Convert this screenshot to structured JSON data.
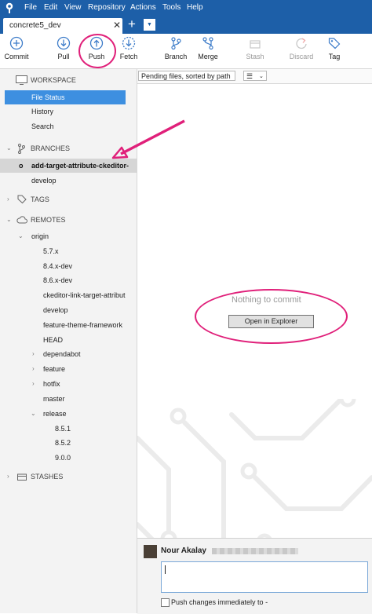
{
  "menu": [
    "File",
    "Edit",
    "View",
    "Repository",
    "Actions",
    "Tools",
    "Help"
  ],
  "tab": {
    "title": "concrete5_dev",
    "close": "✕",
    "add": "+",
    "dropdown": "▼"
  },
  "toolbar": {
    "commit": "Commit",
    "pull": "Pull",
    "push": "Push",
    "fetch": "Fetch",
    "branch": "Branch",
    "merge": "Merge",
    "stash": "Stash",
    "discard": "Discard",
    "tag": "Tag"
  },
  "sidebar": {
    "workspace": "WORKSPACE",
    "workspace_items": [
      "File Status",
      "History",
      "Search"
    ],
    "branches": "BRANCHES",
    "branch_items": [
      "add-target-attribute-ckeditor-",
      "develop"
    ],
    "current_branch_marker": "o",
    "tags": "TAGS",
    "remotes": "REMOTES",
    "remote_origin": "origin",
    "remote_items": [
      "5.7.x",
      "8.4.x-dev",
      "8.6.x-dev",
      "ckeditor-link-target-attribut",
      "develop",
      "feature-theme-framework",
      "HEAD"
    ],
    "remote_folders": [
      "dependabot",
      "feature",
      "hotfix"
    ],
    "remote_master": "master",
    "remote_release": "release",
    "release_items": [
      "8.5.1",
      "8.5.2",
      "9.0.0"
    ],
    "stashes": "STASHES"
  },
  "filterbar": {
    "sort": "Pending files, sorted by path",
    "view": "☰"
  },
  "empty": {
    "message": "Nothing to commit",
    "button": "Open in Explorer"
  },
  "commit": {
    "author": "Nour Akalay",
    "push_immediately": "Push changes immediately to -"
  },
  "colors": {
    "accent": "#1d5fa8",
    "selection": "#3d8fe0",
    "annotation": "#e0207a"
  }
}
